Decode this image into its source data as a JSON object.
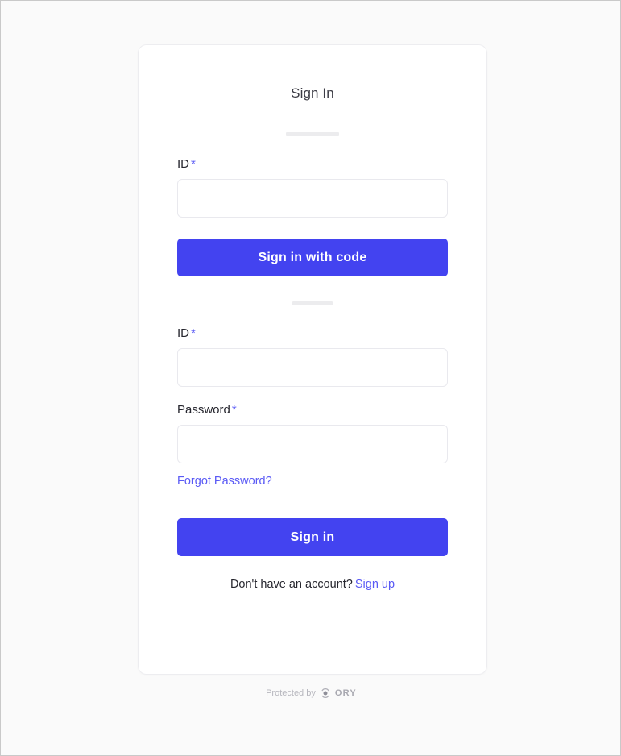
{
  "page": {
    "background_color": "#fafafa",
    "accent_color": "#4343f0",
    "link_color": "#5a5af5"
  },
  "card": {
    "title": "Sign In"
  },
  "code_section": {
    "id_field": {
      "label": "ID",
      "required_mark": "*",
      "value": "",
      "placeholder": ""
    },
    "submit_label": "Sign in with code"
  },
  "password_section": {
    "id_field": {
      "label": "ID",
      "required_mark": "*",
      "value": "",
      "placeholder": ""
    },
    "password_field": {
      "label": "Password",
      "required_mark": "*",
      "value": "",
      "placeholder": ""
    },
    "forgot_password_label": "Forgot Password?",
    "submit_label": "Sign in"
  },
  "signup": {
    "prompt": "Don't have an account?",
    "link_label": "Sign up"
  },
  "footer": {
    "protected_by": "Protected by",
    "brand": "ORY",
    "logo_icon": "ory-circle-logo-icon"
  }
}
